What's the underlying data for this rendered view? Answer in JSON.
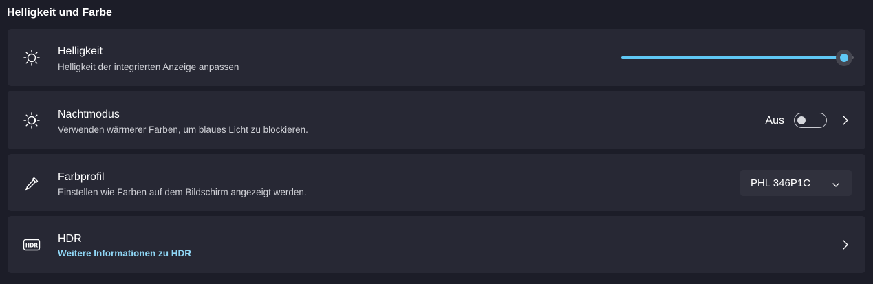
{
  "section": {
    "title": "Helligkeit und Farbe"
  },
  "brightness": {
    "icon": "sun-icon",
    "title": "Helligkeit",
    "subtitle": "Helligkeit der integrierten Anzeige anpassen",
    "level_percent": 96,
    "accent_color": "#5fc8f5"
  },
  "night_mode": {
    "icon": "night-mode-icon",
    "title": "Nachtmodus",
    "subtitle": "Verwenden wärmerer Farben, um blaues Licht zu blockieren.",
    "state_label": "Aus",
    "state": false
  },
  "color_profile": {
    "icon": "eyedropper-icon",
    "title": "Farbprofil",
    "subtitle": "Einstellen wie Farben auf dem Bildschirm angezeigt werden.",
    "selected": "PHL 346P1C"
  },
  "hdr": {
    "icon": "hdr-icon",
    "title": "HDR",
    "link": "Weitere Informationen zu HDR",
    "link_color": "#8fd6f5"
  }
}
